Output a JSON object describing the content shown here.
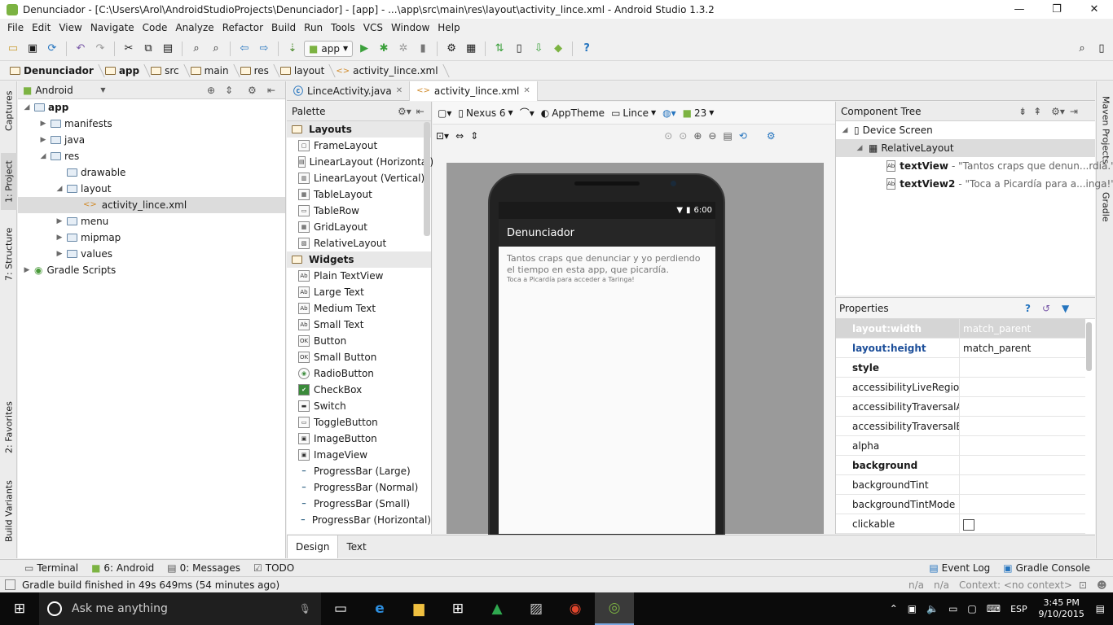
{
  "window": {
    "title": "Denunciador - [C:\\Users\\Arol\\AndroidStudioProjects\\Denunciador] - [app] - ...\\app\\src\\main\\res\\layout\\activity_lince.xml - Android Studio 1.3.2"
  },
  "menu": [
    "File",
    "Edit",
    "View",
    "Navigate",
    "Code",
    "Analyze",
    "Refactor",
    "Build",
    "Run",
    "Tools",
    "VCS",
    "Window",
    "Help"
  ],
  "toolbar": {
    "run_config": "app"
  },
  "breadcrumbs": [
    "Denunciador",
    "app",
    "src",
    "main",
    "res",
    "layout",
    "activity_lince.xml"
  ],
  "left_strip": [
    "1: Project",
    "7: Structure",
    "Captures",
    "2: Favorites",
    "Build Variants"
  ],
  "right_strip": [
    "Maven Projects",
    "Gradle"
  ],
  "project": {
    "view_mode": "Android",
    "tree": [
      {
        "label": "app",
        "level": 0,
        "open": true,
        "bold": true
      },
      {
        "label": "manifests",
        "level": 1,
        "open": false
      },
      {
        "label": "java",
        "level": 1,
        "open": false
      },
      {
        "label": "res",
        "level": 1,
        "open": true
      },
      {
        "label": "drawable",
        "level": 2,
        "open": null
      },
      {
        "label": "layout",
        "level": 2,
        "open": true
      },
      {
        "label": "activity_lince.xml",
        "level": 3,
        "open": null,
        "file": true,
        "selected": true
      },
      {
        "label": "menu",
        "level": 2,
        "open": false
      },
      {
        "label": "mipmap",
        "level": 2,
        "open": false
      },
      {
        "label": "values",
        "level": 2,
        "open": false
      },
      {
        "label": "Gradle Scripts",
        "level": 0,
        "open": false,
        "gradle": true
      }
    ]
  },
  "editor_tabs": [
    {
      "label": "LinceActivity.java",
      "active": false
    },
    {
      "label": "activity_lince.xml",
      "active": true
    }
  ],
  "palette": {
    "title": "Palette",
    "groups": [
      {
        "name": "Layouts",
        "items": [
          "FrameLayout",
          "LinearLayout (Horizontal)",
          "LinearLayout (Vertical)",
          "TableLayout",
          "TableRow",
          "GridLayout",
          "RelativeLayout"
        ]
      },
      {
        "name": "Widgets",
        "items": [
          "Plain TextView",
          "Large Text",
          "Medium Text",
          "Small Text",
          "Button",
          "Small Button",
          "RadioButton",
          "CheckBox",
          "Switch",
          "ToggleButton",
          "ImageButton",
          "ImageView",
          "ProgressBar (Large)",
          "ProgressBar (Normal)",
          "ProgressBar (Small)",
          "ProgressBar (Horizontal)"
        ]
      }
    ]
  },
  "designer": {
    "device": "Nexus 6",
    "theme": "AppTheme",
    "activity": "Lince",
    "api": "23"
  },
  "device_screen": {
    "time": "6:00",
    "app_title": "Denunciador",
    "text1": "Tantos craps que denunciar y yo perdiendo el tiempo en esta app, que picardía.",
    "text2": "Toca a Picardía para acceder a Taringa!"
  },
  "bottom_tabs": [
    {
      "label": "Design",
      "active": true
    },
    {
      "label": "Text",
      "active": false
    }
  ],
  "component_tree": {
    "title": "Component Tree",
    "root": "Device Screen",
    "layout": "RelativeLayout",
    "children": [
      {
        "id": "textView",
        "desc": "- \"Tantos craps que denun...rdía.\""
      },
      {
        "id": "textView2",
        "desc": "- \"Toca a Picardía para a...inga!\""
      }
    ]
  },
  "properties": {
    "title": "Properties",
    "rows": [
      {
        "name": "layout:width",
        "value": "match_parent",
        "kind": "selected"
      },
      {
        "name": "layout:height",
        "value": "match_parent",
        "kind": "blue"
      },
      {
        "name": "style",
        "value": "",
        "kind": "bold"
      },
      {
        "name": "accessibilityLiveRegion",
        "value": "",
        "kind": ""
      },
      {
        "name": "accessibilityTraversalAfte",
        "value": "",
        "kind": ""
      },
      {
        "name": "accessibilityTraversalBefc",
        "value": "",
        "kind": ""
      },
      {
        "name": "alpha",
        "value": "",
        "kind": ""
      },
      {
        "name": "background",
        "value": "",
        "kind": "bold"
      },
      {
        "name": "backgroundTint",
        "value": "",
        "kind": ""
      },
      {
        "name": "backgroundTintMode",
        "value": "",
        "kind": ""
      },
      {
        "name": "clickable",
        "value": "",
        "kind": "check"
      }
    ]
  },
  "tool_windows_left": [
    {
      "label": "Terminal",
      "icon": "terminal-icon"
    },
    {
      "label": "6: Android",
      "icon": "android-icon"
    },
    {
      "label": "0: Messages",
      "icon": "messages-icon"
    },
    {
      "label": "TODO",
      "icon": "todo-icon"
    }
  ],
  "tool_windows_right": [
    {
      "label": "Event Log",
      "icon": "event-log-icon"
    },
    {
      "label": "Gradle Console",
      "icon": "gradle-console-icon"
    }
  ],
  "status": {
    "message": "Gradle build finished in 49s 649ms (54 minutes ago)",
    "na1": "n/a",
    "na2": "n/a",
    "context": "Context: <no context>"
  },
  "taskbar": {
    "search": "Ask me anything",
    "time": "3:45 PM",
    "date": "9/10/2015",
    "lang": "ESP"
  },
  "colors": {
    "accent": "#2675bf",
    "android_green": "#7cb342",
    "selected": "#d5d5d5"
  }
}
